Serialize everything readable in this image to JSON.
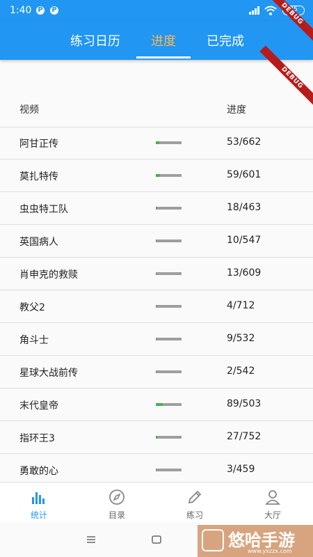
{
  "status_bar": {
    "time": "1:40",
    "app_badges": [
      "P",
      "P"
    ],
    "battery": "75"
  },
  "debug_banner": "DEBUG",
  "tabs": [
    {
      "label": "练习日历",
      "active": false
    },
    {
      "label": "进度",
      "active": true
    },
    {
      "label": "已完成",
      "active": false
    }
  ],
  "table": {
    "headers": {
      "video": "视频",
      "progress": "进度"
    },
    "rows": [
      {
        "name": "阿甘正传",
        "count": "53/662",
        "fraction": 0.08
      },
      {
        "name": "莫扎特传",
        "count": "59/601",
        "fraction": 0.098
      },
      {
        "name": "虫虫特工队",
        "count": "18/463",
        "fraction": 0.039
      },
      {
        "name": "英国病人",
        "count": "10/547",
        "fraction": 0.018
      },
      {
        "name": "肖申克的救赎",
        "count": "13/609",
        "fraction": 0.021
      },
      {
        "name": "教父2",
        "count": "4/712",
        "fraction": 0.006
      },
      {
        "name": "角斗士",
        "count": "9/532",
        "fraction": 0.017
      },
      {
        "name": "星球大战前传",
        "count": "2/542",
        "fraction": 0.004
      },
      {
        "name": "末代皇帝",
        "count": "89/503",
        "fraction": 0.177
      },
      {
        "name": "指环王3",
        "count": "27/752",
        "fraction": 0.036
      },
      {
        "name": "勇敢的心",
        "count": "3/459",
        "fraction": 0.007
      }
    ]
  },
  "bottom_nav": [
    {
      "label": "统计",
      "icon": "bar-chart-icon",
      "active": true
    },
    {
      "label": "目录",
      "icon": "compass-icon",
      "active": false
    },
    {
      "label": "练习",
      "icon": "pencil-icon",
      "active": false
    },
    {
      "label": "大厅",
      "icon": "person-icon",
      "active": false
    }
  ],
  "watermark": {
    "text": "悠哈手游",
    "url": "www.yxzzx.com"
  },
  "colors": {
    "primary": "#2196f3",
    "active_tab": "#ffb74d",
    "progress_fill": "#4caf50",
    "progress_track": "#9e9e9e"
  }
}
